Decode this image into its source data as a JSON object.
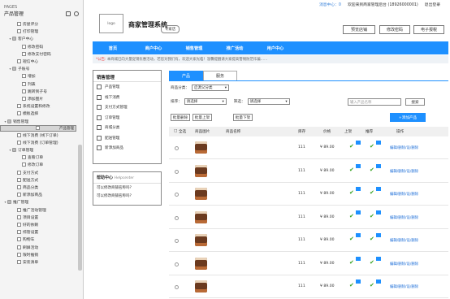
{
  "tree": {
    "pages_label": "PAGES",
    "header": "产品管理",
    "items": [
      {
        "label": "房屋评分",
        "indent": 2,
        "type": "page"
      },
      {
        "label": "打印管理",
        "indent": 2,
        "type": "page"
      },
      {
        "label": "客户中心",
        "indent": 1,
        "type": "folder",
        "open": true
      },
      {
        "label": "修改密码",
        "indent": 3,
        "type": "page"
      },
      {
        "label": "修改支付密码",
        "indent": 3,
        "type": "page"
      },
      {
        "label": "短信中心",
        "indent": 2,
        "type": "page"
      },
      {
        "label": "子账号",
        "indent": 1,
        "type": "folder",
        "open": true
      },
      {
        "label": "增加",
        "indent": 3,
        "type": "page"
      },
      {
        "label": "列表",
        "indent": 3,
        "type": "page"
      },
      {
        "label": "跳转到子号",
        "indent": 3,
        "type": "page"
      },
      {
        "label": "添加图片",
        "indent": 3,
        "type": "page"
      },
      {
        "label": "系统设置和修改",
        "indent": 2,
        "type": "page"
      },
      {
        "label": "模板选择",
        "indent": 2,
        "type": "page"
      },
      {
        "label": "销售管理",
        "indent": 0,
        "type": "folder",
        "open": true
      },
      {
        "label": "产品管理",
        "indent": 2,
        "type": "page",
        "selected": true
      },
      {
        "label": "线下消费 (线下订单)",
        "indent": 2,
        "type": "page"
      },
      {
        "label": "线下消费 (订单管理)",
        "indent": 2,
        "type": "page"
      },
      {
        "label": "订单管理",
        "indent": 1,
        "type": "folder",
        "open": true
      },
      {
        "label": "查看订单",
        "indent": 3,
        "type": "page"
      },
      {
        "label": "修改订单",
        "indent": 3,
        "type": "page"
      },
      {
        "label": "支付方式",
        "indent": 2,
        "type": "page"
      },
      {
        "label": "配送方式",
        "indent": 2,
        "type": "page"
      },
      {
        "label": "商品分类",
        "indent": 2,
        "type": "page"
      },
      {
        "label": "新添加商品",
        "indent": 2,
        "type": "page"
      },
      {
        "label": "推广管理",
        "indent": 0,
        "type": "folder",
        "open": true
      },
      {
        "label": "推广活动管理",
        "indent": 2,
        "type": "page"
      },
      {
        "label": "项目设置",
        "indent": 2,
        "type": "page"
      },
      {
        "label": "好的依赖",
        "indent": 2,
        "type": "page"
      },
      {
        "label": "综管设置",
        "indent": 2,
        "type": "page"
      },
      {
        "label": "购物车",
        "indent": 2,
        "type": "page"
      },
      {
        "label": "刷屏活动",
        "indent": 2,
        "type": "page"
      },
      {
        "label": "限时推销",
        "indent": 2,
        "type": "page"
      },
      {
        "label": "安装清单",
        "indent": 2,
        "type": "page"
      }
    ]
  },
  "topbar": {
    "messages": "消息中心：0",
    "welcome": "欢迎来到商家管理后台 (18926000001)",
    "logout": "退出登录"
  },
  "header": {
    "logo": "logo",
    "title": "商家管理系统",
    "badge": "专家店",
    "buttons": [
      "预览店铺",
      "修改密码",
      "电子报税"
    ]
  },
  "nav": [
    "首页",
    "商户中心",
    "销售管理",
    "推广活动",
    "用户中心"
  ],
  "notice": {
    "prefix": "*公告:",
    "text": " 本商城已向大量促销优惠活动，若您对我们有，欢迎大家光临！温馨提醒请大家提高警惕防范诈骗……"
  },
  "side_menu": {
    "title": "销售管理",
    "items": [
      "产品管理",
      "线下消费",
      "支付方式管理",
      "订单管理",
      "商城分类",
      "配送管理",
      "新添加商品"
    ]
  },
  "help": {
    "title": "帮助中心",
    "subtitle": "Helpcenter",
    "links": [
      "可以修改商铺名称吗?",
      "可以修改商铺名称吗?"
    ]
  },
  "tabs": [
    "产品",
    "服务"
  ],
  "filters": {
    "category_label": "商品分类：",
    "category_value": "启源父分类",
    "sort_label": "排序：",
    "sort_value": "请选择",
    "filter_label": "筛选：",
    "filter_value": "请选择",
    "search_placeholder": "输入产品名称",
    "search_button": "搜索",
    "batch_delete": "批量删除",
    "batch_on": "批量上架",
    "batch_off": "批量下架",
    "add_product": "+添加产品"
  },
  "table": {
    "headers": [
      "全选",
      "商品图片",
      "商品名称",
      "库存",
      "价格",
      "上架",
      "推荐",
      "操作"
    ],
    "rows": [
      {
        "stock": "111",
        "price": "¥ 89.00",
        "ops": "编辑/删除/设/删除"
      },
      {
        "stock": "111",
        "price": "¥ 89.00",
        "ops": "编辑/删除/设/删除"
      },
      {
        "stock": "111",
        "price": "¥ 89.00",
        "ops": "编辑/删除/设/删除"
      },
      {
        "stock": "111",
        "price": "¥ 89.00",
        "ops": "编辑/删除/设/删除"
      },
      {
        "stock": "111",
        "price": "¥ 89.00",
        "ops": "编辑/删除/设/删除"
      },
      {
        "stock": "111",
        "price": "¥ 89.00",
        "ops": "编辑/删除/设/删除"
      },
      {
        "stock": "111",
        "price": "¥ 89.00",
        "ops": "编辑/删除/设/删除"
      }
    ]
  }
}
